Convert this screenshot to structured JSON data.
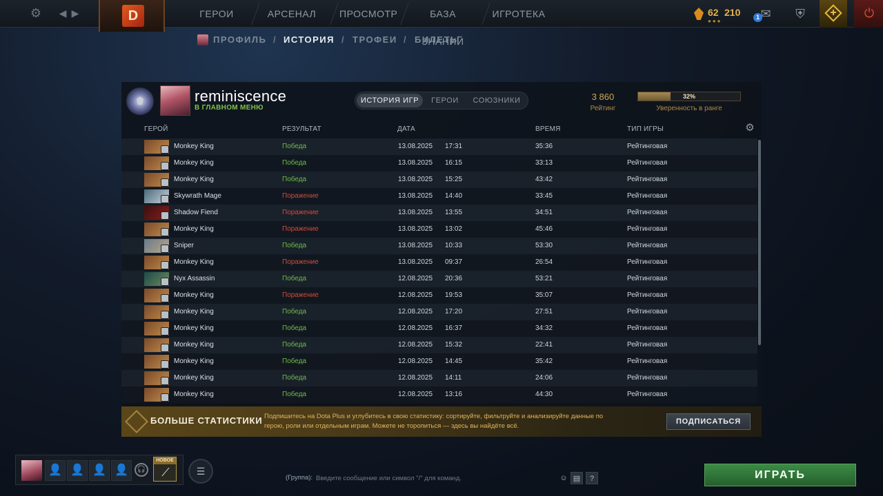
{
  "topbar": {
    "nav": [
      "ГЕРОИ",
      "АРСЕНАЛ",
      "ПРОСМОТР",
      "БАЗА ЗНАНИЙ",
      "ИГРОТЕКА"
    ],
    "shards": "62",
    "shards_b": "210",
    "shards_dots": "●●●",
    "notification_count": "1",
    "dota_logo": "D"
  },
  "subnav": {
    "profile": "ПРОФИЛЬ",
    "history": "ИСТОРИЯ",
    "trophies": "ТРОФЕИ",
    "tickets": "БИЛЕТЫ",
    "separator": "/"
  },
  "player": {
    "name": "reminiscence",
    "status": "В ГЛАВНОМ МЕНЮ"
  },
  "tabs": {
    "history": "ИСТОРИЯ ИГР",
    "heroes": "ГЕРОИ",
    "allies": "СОЮЗНИКИ"
  },
  "rating": {
    "value": "3 860",
    "label": "Рейтинг",
    "confidence_pct": "32%",
    "confidence_fraction": 0.32,
    "confidence_label": "Уверенность в ранге"
  },
  "columns": {
    "hero": "ГЕРОЙ",
    "result": "РЕЗУЛЬТАТ",
    "date": "ДАТА",
    "duration": "ВРЕМЯ",
    "type": "ТИП ИГРЫ"
  },
  "matches": [
    {
      "hero": "Monkey King",
      "result": "Победа",
      "win": true,
      "date": "13.08.2025",
      "time": "17:31",
      "duration": "35:36",
      "type": "Рейтинговая"
    },
    {
      "hero": "Monkey King",
      "result": "Победа",
      "win": true,
      "date": "13.08.2025",
      "time": "16:15",
      "duration": "33:13",
      "type": "Рейтинговая"
    },
    {
      "hero": "Monkey King",
      "result": "Победа",
      "win": true,
      "date": "13.08.2025",
      "time": "15:25",
      "duration": "43:42",
      "type": "Рейтинговая"
    },
    {
      "hero": "Skywrath Mage",
      "result": "Поражение",
      "win": false,
      "date": "13.08.2025",
      "time": "14:40",
      "duration": "33:45",
      "type": "Рейтинговая"
    },
    {
      "hero": "Shadow Fiend",
      "result": "Поражение",
      "win": false,
      "date": "13.08.2025",
      "time": "13:55",
      "duration": "34:51",
      "type": "Рейтинговая"
    },
    {
      "hero": "Monkey King",
      "result": "Поражение",
      "win": false,
      "date": "13.08.2025",
      "time": "13:02",
      "duration": "45:46",
      "type": "Рейтинговая"
    },
    {
      "hero": "Sniper",
      "result": "Победа",
      "win": true,
      "date": "13.08.2025",
      "time": "10:33",
      "duration": "53:30",
      "type": "Рейтинговая"
    },
    {
      "hero": "Monkey King",
      "result": "Поражение",
      "win": false,
      "date": "13.08.2025",
      "time": "09:37",
      "duration": "26:54",
      "type": "Рейтинговая"
    },
    {
      "hero": "Nyx Assassin",
      "result": "Победа",
      "win": true,
      "date": "12.08.2025",
      "time": "20:36",
      "duration": "53:21",
      "type": "Рейтинговая"
    },
    {
      "hero": "Monkey King",
      "result": "Поражение",
      "win": false,
      "date": "12.08.2025",
      "time": "19:53",
      "duration": "35:07",
      "type": "Рейтинговая"
    },
    {
      "hero": "Monkey King",
      "result": "Победа",
      "win": true,
      "date": "12.08.2025",
      "time": "17:20",
      "duration": "27:51",
      "type": "Рейтинговая"
    },
    {
      "hero": "Monkey King",
      "result": "Победа",
      "win": true,
      "date": "12.08.2025",
      "time": "16:37",
      "duration": "34:32",
      "type": "Рейтинговая"
    },
    {
      "hero": "Monkey King",
      "result": "Победа",
      "win": true,
      "date": "12.08.2025",
      "time": "15:32",
      "duration": "22:41",
      "type": "Рейтинговая"
    },
    {
      "hero": "Monkey King",
      "result": "Победа",
      "win": true,
      "date": "12.08.2025",
      "time": "14:45",
      "duration": "35:42",
      "type": "Рейтинговая"
    },
    {
      "hero": "Monkey King",
      "result": "Победа",
      "win": true,
      "date": "12.08.2025",
      "time": "14:11",
      "duration": "24:06",
      "type": "Рейтинговая"
    },
    {
      "hero": "Monkey King",
      "result": "Победа",
      "win": true,
      "date": "12.08.2025",
      "time": "13:16",
      "duration": "44:30",
      "type": "Рейтинговая"
    }
  ],
  "hero_icon_colors": {
    "Monkey King": [
      "#7a4a2a",
      "#c08a4a"
    ],
    "Skywrath Mage": [
      "#4a6a7a",
      "#c9d3da"
    ],
    "Shadow Fiend": [
      "#3a1010",
      "#8a1d1d"
    ],
    "Sniper": [
      "#6a7a8a",
      "#b8a88a"
    ],
    "Nyx Assassin": [
      "#1e4a4a",
      "#6a8a5a"
    ]
  },
  "promo": {
    "title": "БОЛЬШЕ СТАТИСТИКИ",
    "text": "Подпишитесь на Dota Plus и углубитесь в свою статистику: сортируйте, фильтруйте и анализируйте данные по герою, роли или отдельным играм. Можете не торопиться — здесь вы найдёте всё.",
    "button": "ПОДПИСАТЬСЯ"
  },
  "bottom": {
    "new_label": "НОВОЕ",
    "chat_prefix": "(Группа):",
    "chat_placeholder": "Введите сообщение или символ \"/\" для команд.",
    "help": "?",
    "play": "ИГРАТЬ"
  }
}
